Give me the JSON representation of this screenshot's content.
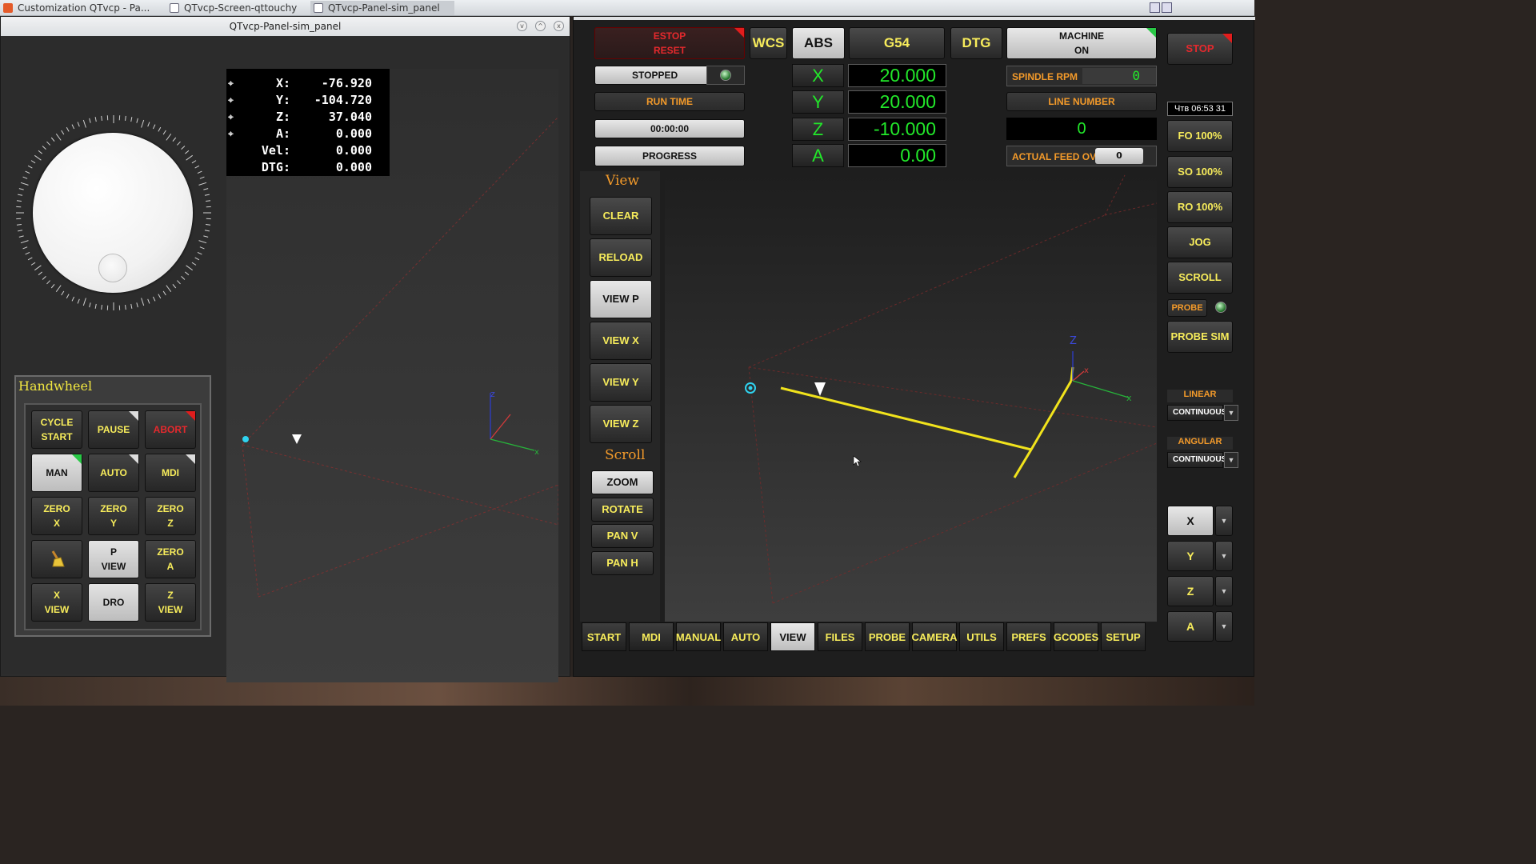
{
  "taskbar": {
    "tasks": [
      "Customization QTvcp - Pa...",
      "QTvcp-Screen-qttouchy",
      "QTvcp-Panel-sim_panel"
    ]
  },
  "left_window": {
    "title": "QTvcp-Panel-sim_panel",
    "dro": [
      {
        "label": "X:",
        "value": "-76.920"
      },
      {
        "label": "Y:",
        "value": "-104.720"
      },
      {
        "label": "Z:",
        "value": "37.040"
      },
      {
        "label": "A:",
        "value": "0.000"
      },
      {
        "label": "Vel:",
        "value": "0.000"
      },
      {
        "label": "DTG:",
        "value": "0.000"
      }
    ],
    "handwheel": {
      "title": "Handwheel",
      "buttons": [
        "CYCLE\nSTART",
        "PAUSE",
        "ABORT",
        "MAN",
        "AUTO",
        "MDI",
        "ZERO\nX",
        "ZERO\nY",
        "ZERO\nZ",
        "",
        "P\nVIEW",
        "ZERO\nA",
        "X\nVIEW",
        "DRO",
        "Z\nVIEW"
      ]
    }
  },
  "right_window": {
    "estop": "ESTOP\nRESET",
    "wcs": "WCS",
    "abs": "ABS",
    "g54": "G54",
    "dtg": "DTG",
    "machine": "MACHINE\nON",
    "stop": "STOP",
    "status": "STOPPED",
    "run_time_label": "RUN TIME",
    "run_time": "00:00:00",
    "progress": "PROGRESS",
    "axes": [
      {
        "axis": "X",
        "value": "20.000"
      },
      {
        "axis": "Y",
        "value": "20.000"
      },
      {
        "axis": "Z",
        "value": "-10.000"
      },
      {
        "axis": "A",
        "value": "0.00"
      }
    ],
    "spindle_label": "SPINDLE RPM",
    "spindle_value": "0",
    "line_number_label": "LINE NUMBER",
    "line_number": "0",
    "feed_ovr_label": "ACTUAL FEED OVR.",
    "feed_ovr": "0",
    "clock": "Чтв 06:53 31",
    "right_buttons": [
      "FO 100%",
      "SO 100%",
      "RO 100%",
      "JOG",
      "SCROLL"
    ],
    "probe_label": "PROBE",
    "probe_sim": "PROBE SIM",
    "linear_label": "LINEAR",
    "linear_value": "CONTINUOUS",
    "angular_label": "ANGULAR",
    "angular_value": "CONTINUOUS",
    "jog_axes": [
      "X",
      "Y",
      "Z",
      "A"
    ],
    "view_title": "View",
    "view_buttons": [
      "CLEAR",
      "RELOAD",
      "VIEW P",
      "VIEW X",
      "VIEW Y",
      "VIEW Z"
    ],
    "scroll_title": "Scroll",
    "scroll_buttons": [
      "ZOOM",
      "ROTATE",
      "PAN V",
      "PAN H"
    ],
    "tabs": [
      "START",
      "MDI",
      "MANUAL",
      "AUTO",
      "VIEW",
      "FILES",
      "PROBE",
      "CAMERA",
      "UTILS",
      "PREFS",
      "GCODES",
      "SETUP"
    ]
  }
}
